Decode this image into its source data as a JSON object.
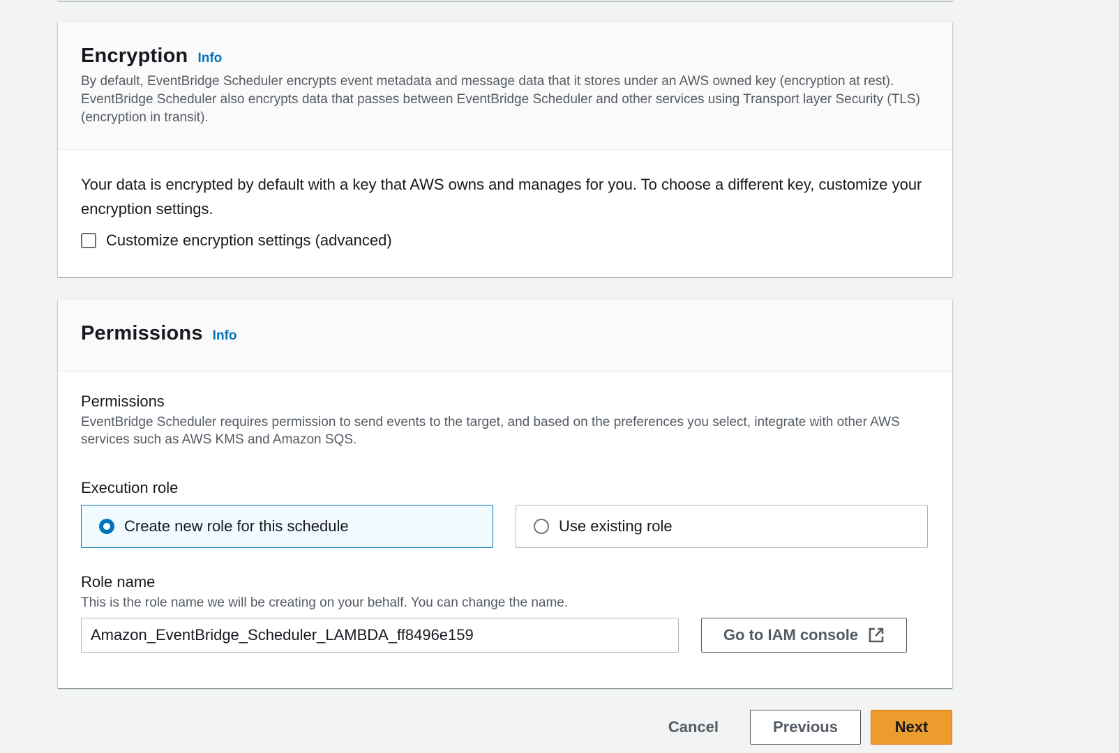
{
  "encryption": {
    "title": "Encryption",
    "info_label": "Info",
    "description": "By default, EventBridge Scheduler encrypts event metadata and message data that it stores under an AWS owned key (encryption at rest). EventBridge Scheduler also encrypts data that passes between EventBridge Scheduler and other services using Transport layer Security (TLS) (encryption in transit).",
    "body_text": "Your data is encrypted by default with a key that AWS owns and manages for you. To choose a different key, customize your encryption settings.",
    "customize_checkbox_label": "Customize encryption settings (advanced)",
    "customize_checked": false
  },
  "permissions": {
    "title": "Permissions",
    "info_label": "Info",
    "section_label": "Permissions",
    "section_description": "EventBridge Scheduler requires permission to send events to the target, and based on the preferences you select, integrate with other AWS services such as AWS KMS and Amazon SQS.",
    "execution_role_label": "Execution role",
    "execution_role_options": [
      {
        "label": "Create new role for this schedule",
        "selected": true
      },
      {
        "label": "Use existing role",
        "selected": false
      }
    ],
    "role_name_label": "Role name",
    "role_name_description": "This is the role name we will be creating on your behalf. You can change the name.",
    "role_name_value": "Amazon_EventBridge_Scheduler_LAMBDA_ff8496e159",
    "iam_button_label": "Go to IAM console",
    "iam_button_icon": "external-link-icon"
  },
  "footer": {
    "cancel_label": "Cancel",
    "previous_label": "Previous",
    "next_label": "Next"
  },
  "colors": {
    "link": "#0073bb",
    "primary_button": "#ec9c2c",
    "selected_tile_bg": "#f1faff",
    "page_bg": "#f2f3f3"
  }
}
